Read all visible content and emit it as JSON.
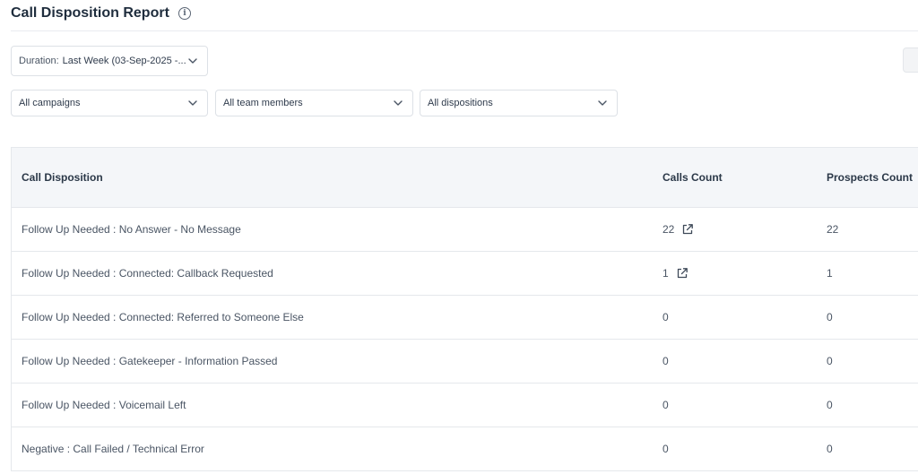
{
  "header": {
    "title": "Call Disposition Report",
    "info_icon": "info-circle-icon"
  },
  "filters": {
    "duration_label": "Duration:",
    "duration_value": "Last Week (03-Sep-2025 -...",
    "campaigns": "All campaigns",
    "team_members": "All team members",
    "dispositions": "All dispositions"
  },
  "table": {
    "headers": {
      "disposition": "Call Disposition",
      "calls": "Calls Count",
      "prospects": "Prospects Count"
    },
    "rows": [
      {
        "disposition": "Follow Up Needed : No Answer - No Message",
        "calls": "22",
        "prospects": "22",
        "link": true
      },
      {
        "disposition": "Follow Up Needed : Connected: Callback Requested",
        "calls": "1",
        "prospects": "1",
        "link": true
      },
      {
        "disposition": "Follow Up Needed : Connected: Referred to Someone Else",
        "calls": "0",
        "prospects": "0",
        "link": false
      },
      {
        "disposition": "Follow Up Needed : Gatekeeper - Information Passed",
        "calls": "0",
        "prospects": "0",
        "link": false
      },
      {
        "disposition": "Follow Up Needed : Voicemail Left",
        "calls": "0",
        "prospects": "0",
        "link": false
      },
      {
        "disposition": "Negative : Call Failed / Technical Error",
        "calls": "0",
        "prospects": "0",
        "link": false
      }
    ]
  }
}
